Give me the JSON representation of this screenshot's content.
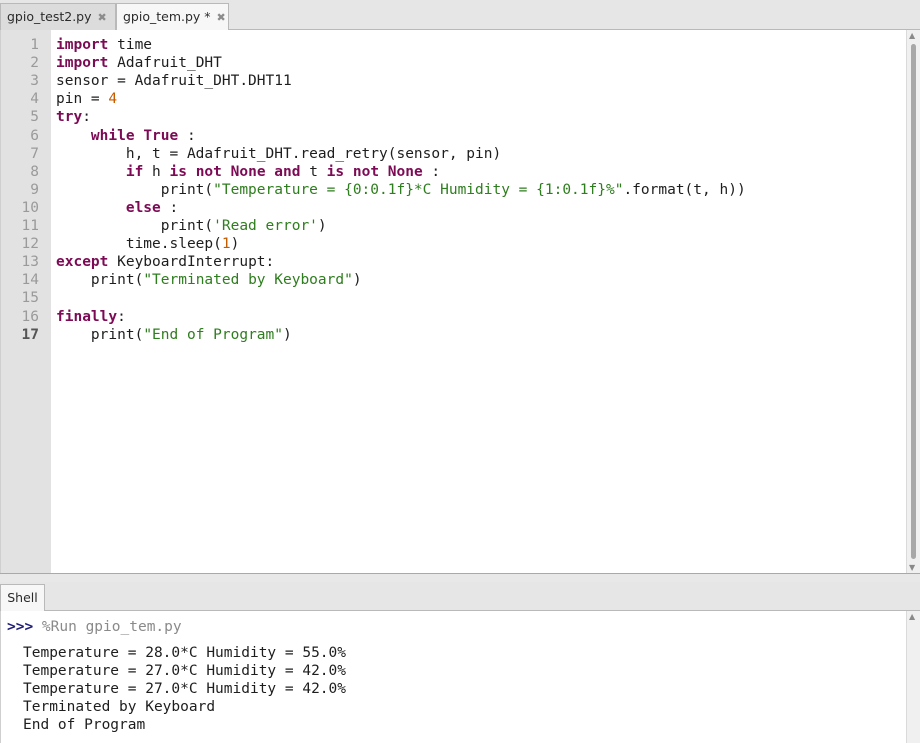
{
  "tabs": [
    {
      "label": "gpio_test2.py",
      "close": "✖"
    },
    {
      "label": "gpio_tem.py *",
      "close": "✖"
    }
  ],
  "editor": {
    "line_numbers": [
      "1",
      "2",
      "3",
      "4",
      "5",
      "6",
      "7",
      "8",
      "9",
      "10",
      "11",
      "12",
      "13",
      "14",
      "15",
      "16",
      "17"
    ],
    "code": {
      "l1_kw": "import",
      "l1_rest": " time",
      "l2_kw": "import",
      "l2_rest": " Adafruit_DHT",
      "l3": "sensor = Adafruit_DHT.DHT11",
      "l4_a": "pin = ",
      "l4_num": "4",
      "l5_kw": "try",
      "l5_rest": ":",
      "l6_indent": "    ",
      "l6_kw1": "while",
      "l6_sp": " ",
      "l6_kw2": "True",
      "l6_rest": " :",
      "l7": "        h, t = Adafruit_DHT.read_retry(sensor, pin)",
      "l8_indent": "        ",
      "l8_kw1": "if",
      "l8_a": " h ",
      "l8_kw2": "is not None and",
      "l8_b": " t ",
      "l8_kw3": "is not None",
      "l8_rest": " :",
      "l9_a": "            print(",
      "l9_str": "\"Temperature = {0:0.1f}*C Humidity = {1:0.1f}%\"",
      "l9_rest": ".format(t, h))",
      "l10_indent": "        ",
      "l10_kw": "else",
      "l10_rest": " :",
      "l11_a": "            print(",
      "l11_str": "'Read error'",
      "l11_rest": ")",
      "l12_a": "        time.sleep(",
      "l12_num": "1",
      "l12_rest": ")",
      "l13_kw": "except",
      "l13_rest": " KeyboardInterrupt:",
      "l14_a": "    print(",
      "l14_str": "\"Terminated by Keyboard\"",
      "l14_rest": ")",
      "l16_kw": "finally",
      "l16_rest": ":",
      "l17_a": "    print(",
      "l17_str": "\"End of Program\"",
      "l17_rest": ")"
    }
  },
  "shell": {
    "tab_label": "Shell",
    "prompt": ">>>",
    "command": " %Run gpio_tem.py",
    "output": [
      "Temperature = 28.0*C Humidity = 55.0%",
      "Temperature = 27.0*C Humidity = 42.0%",
      "Temperature = 27.0*C Humidity = 42.0%",
      "Terminated by Keyboard",
      "End of Program"
    ]
  },
  "colors": {
    "keyword": "#7c0a55",
    "string": "#2e7d1e",
    "number": "#c45c00"
  }
}
